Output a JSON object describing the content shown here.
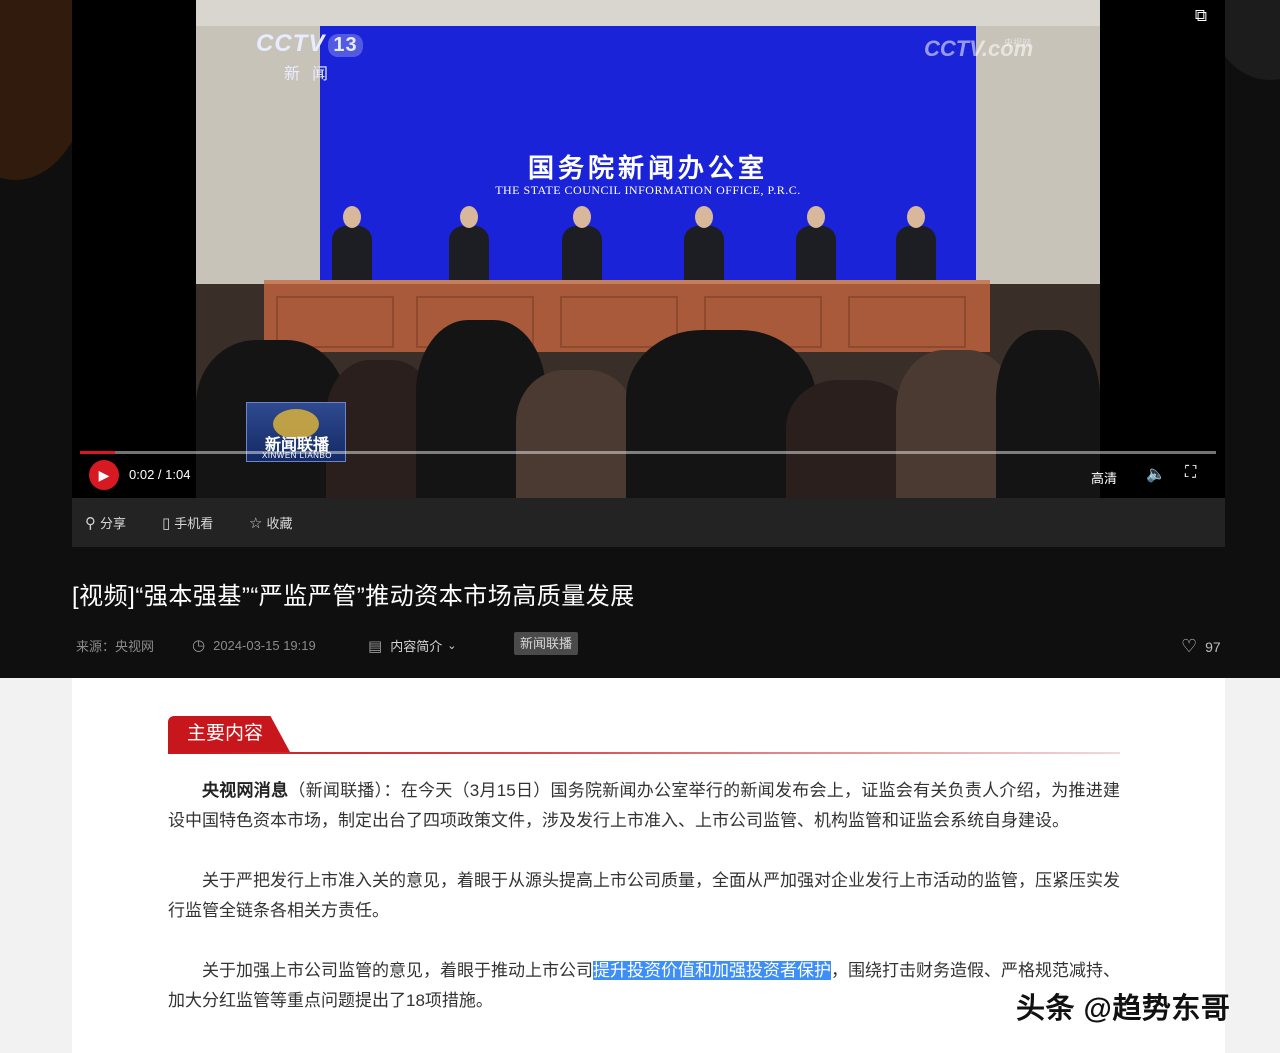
{
  "video": {
    "channel_logo": "CCTV",
    "channel_number": "13",
    "channel_sub": "新闻",
    "site_logo": "CCTV.com",
    "site_logo_sub": "央视网",
    "backdrop_cn": "国务院新闻办公室",
    "backdrop_en": "THE STATE COUNCIL INFORMATION OFFICE, P.R.C.",
    "program_badge_cn": "新闻联播",
    "program_badge_en": "XINWEN LIANBO",
    "time": "0:02 / 1:04",
    "progress_fraction": 0.031,
    "quality": "高清",
    "accent_color": "#d71a21"
  },
  "actions": {
    "share": "分享",
    "mobile": "手机看",
    "favorite": "收藏"
  },
  "article": {
    "title": "[视频]“强本强基”“严监严管”推动资本市场高质量发展",
    "source": "来源：央视网",
    "datetime": "2024-03-15 19:19",
    "summary_toggle": "内容简介",
    "tag": "新闻联播",
    "likes": "97",
    "section_title": "主要内容",
    "p1_lead": "央视网消息",
    "p1_rest": "（新闻联播）：在今天（3月15日）国务院新闻办公室举行的新闻发布会上，证监会有关负责人介绍，为推进建设中国特色资本市场，制定出台了四项政策文件，涉及发行上市准入、上市公司监管、机构监管和证监会系统自身建设。",
    "p2": "关于严把发行上市准入关的意见，着眼于从源头提高上市公司质量，全面从严加强对企业发行上市活动的监管，压紧压实发行监管全链条各相关方责任。",
    "p3_a": "关于加强上市公司监管的意见，着眼于推动上市公司",
    "p3_highlight": "提升投资价值和加强投资者保护",
    "p3_b": "，围绕打击财务造假、严格规范减持、加大分红监管等重点问题提出了18项措施。"
  },
  "watermark": "头条 @趋势东哥",
  "icons": {
    "pip": "picture-in-picture-icon",
    "play": "play-icon",
    "volume": "volume-icon",
    "fullscreen": "fullscreen-icon",
    "share": "share-icon",
    "mobile": "mobile-icon",
    "favorite": "star-icon",
    "clock": "clock-icon",
    "summary": "document-icon",
    "like": "heart-icon"
  }
}
